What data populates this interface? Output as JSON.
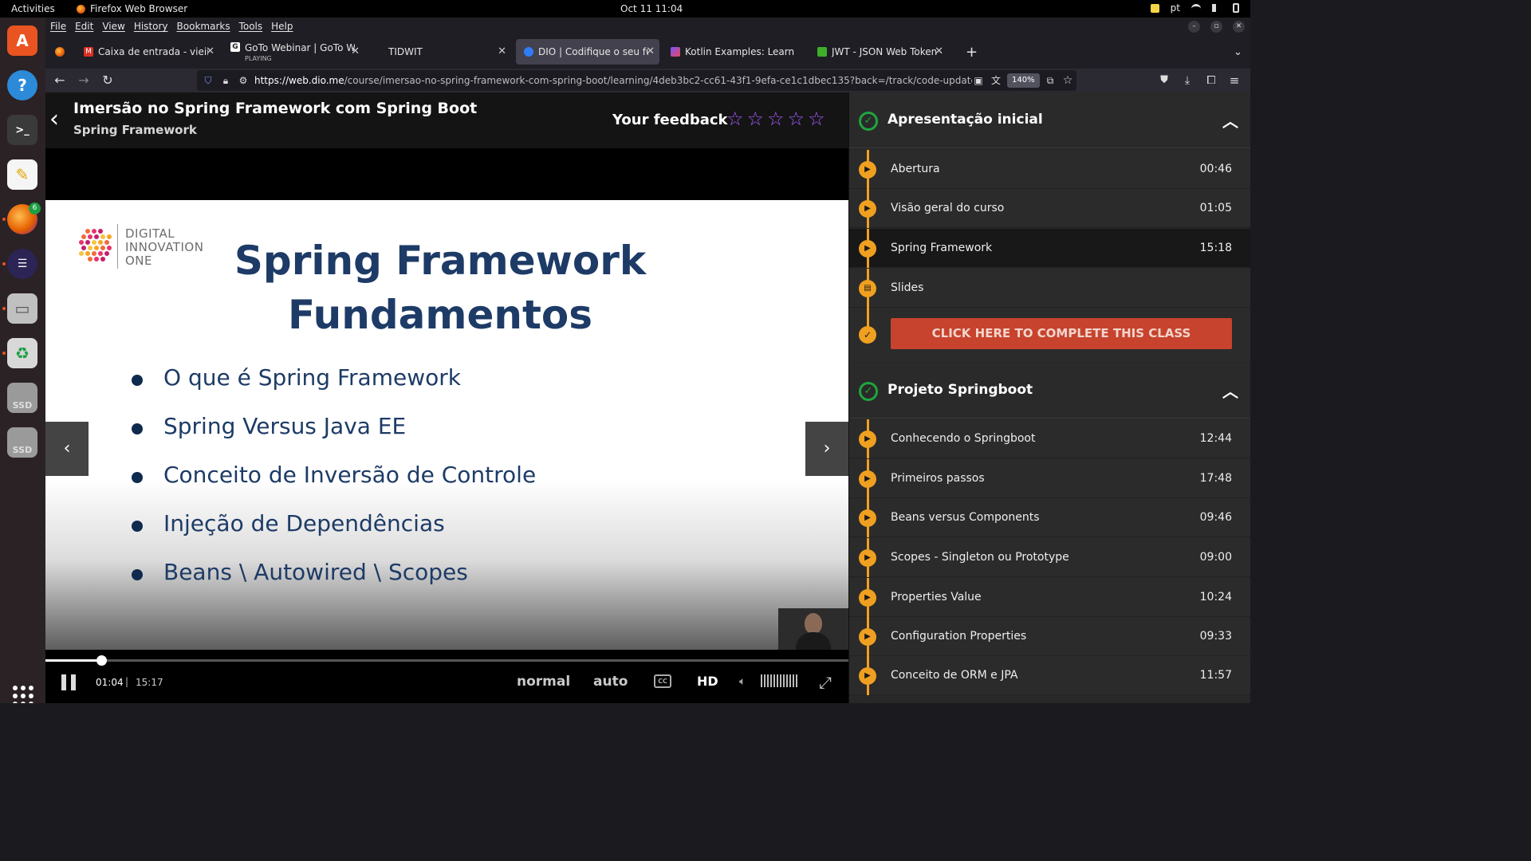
{
  "system": {
    "activities": "Activities",
    "app_name": "Firefox Web Browser",
    "clock": "Oct 11  11:04",
    "lang": "pt"
  },
  "dock": {
    "firefox_badge": "6",
    "ssd1": "SSD",
    "ssd2": "SSD"
  },
  "menubar": [
    "File",
    "Edit",
    "View",
    "History",
    "Bookmarks",
    "Tools",
    "Help"
  ],
  "tabs": [
    {
      "title": "Caixa de entrada - vieira.f",
      "icon": "gmail-icon",
      "color": "#d93025"
    },
    {
      "title": "GoTo Webinar | GoTo We",
      "subtitle": "PLAYING",
      "icon": "goto-icon",
      "color": "#ffffff"
    },
    {
      "title": "TIDWIT",
      "icon": "",
      "color": ""
    },
    {
      "title": "DIO | Codifique o seu futu",
      "icon": "dio-icon",
      "color": "#2f7cf6"
    },
    {
      "title": "Kotlin Examples: Learn Ko",
      "icon": "kotlin-icon",
      "color": "#7f52ff"
    },
    {
      "title": "JWT - JSON Web Token -",
      "icon": "jwt-icon",
      "color": "#3fae2a"
    }
  ],
  "navbar": {
    "url_host": "https://web.dio.me",
    "url_path": "/course/imersao-no-spring-framework-com-spring-boot/learning/4deb3bc2-cc61-43f1-9efa-ce1c1dbec135?back=/track/code-update-tqi-ba",
    "zoom": "140%"
  },
  "course": {
    "title": "Imersão no Spring Framework com Spring Boot",
    "subtitle": "Spring Framework",
    "feedback_label": "Your feedback",
    "rating_stars": 5
  },
  "slide": {
    "logo_lines": [
      "DIGITAL",
      "INNOVATION",
      "ONE"
    ],
    "title_line1": "Spring Framework",
    "title_line2": "Fundamentos",
    "bullets": [
      "O que é Spring Framework",
      "Spring Versus Java EE",
      "Conceito de Inversão de Controle",
      "Injeção de Dependências",
      "Beans \\ Autowired \\ Scopes"
    ]
  },
  "player": {
    "current_time": "01:04",
    "separator": "|",
    "total_time": "15:17",
    "progress_fraction": 0.07,
    "speed_label": "normal",
    "quality_label": "auto",
    "cc_label": "CC",
    "hd_label": "HD"
  },
  "sidebar": {
    "sections": [
      {
        "title": "Apresentação inicial",
        "lessons": [
          {
            "title": "Abertura",
            "time": "00:46"
          },
          {
            "title": "Visão geral do curso",
            "time": "01:05"
          },
          {
            "title": "Spring Framework",
            "time": "15:18",
            "current": true
          },
          {
            "title": "Slides",
            "time": ""
          }
        ],
        "complete_button": "CLICK HERE TO COMPLETE THIS CLASS"
      },
      {
        "title": "Projeto Springboot",
        "lessons": [
          {
            "title": "Conhecendo o Springboot",
            "time": "12:44"
          },
          {
            "title": "Primeiros passos",
            "time": "17:48"
          },
          {
            "title": "Beans versus Components",
            "time": "09:46"
          },
          {
            "title": "Scopes - Singleton ou Prototype",
            "time": "09:00"
          },
          {
            "title": "Properties Value",
            "time": "10:24"
          },
          {
            "title": "Configuration Properties",
            "time": "09:33"
          },
          {
            "title": "Conceito de ORM e JPA",
            "time": "11:57"
          }
        ]
      }
    ]
  },
  "colors": {
    "accent_orange": "#f0a020",
    "complete_red": "#c7432d",
    "check_green": "#1fa53c",
    "star_purple": "#a55bff",
    "slide_navy": "#1d3b66"
  }
}
